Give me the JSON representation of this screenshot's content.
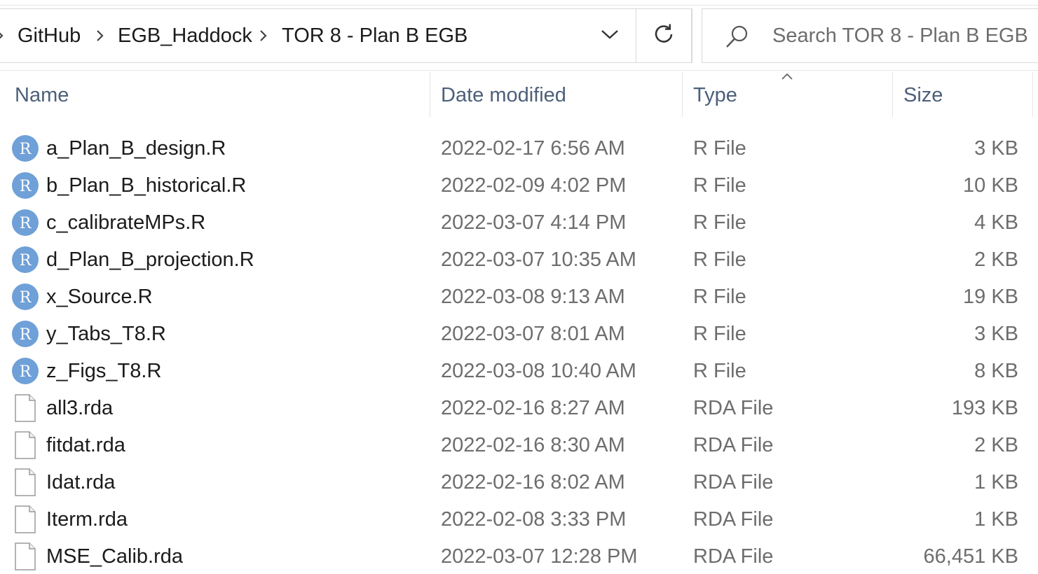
{
  "breadcrumb": {
    "items": [
      "GitHub",
      "EGB_Haddock",
      "TOR 8 - Plan B EGB"
    ]
  },
  "search": {
    "placeholder": "Search TOR 8 - Plan B EGB"
  },
  "columns": {
    "name": "Name",
    "date": "Date modified",
    "type": "Type",
    "size": "Size"
  },
  "icons": {
    "r_file": "r-file-icon",
    "generic_file": "generic-file-icon",
    "r_letter": "R",
    "r_icon_color": "#6fa0d8"
  },
  "files": [
    {
      "name": "a_Plan_B_design.R",
      "date": "2022-02-17 6:56 AM",
      "type": "R File",
      "size": "3 KB",
      "icon": "r"
    },
    {
      "name": "b_Plan_B_historical.R",
      "date": "2022-02-09 4:02 PM",
      "type": "R File",
      "size": "10 KB",
      "icon": "r"
    },
    {
      "name": "c_calibrateMPs.R",
      "date": "2022-03-07 4:14 PM",
      "type": "R File",
      "size": "4 KB",
      "icon": "r"
    },
    {
      "name": "d_Plan_B_projection.R",
      "date": "2022-03-07 10:35 AM",
      "type": "R File",
      "size": "2 KB",
      "icon": "r"
    },
    {
      "name": "x_Source.R",
      "date": "2022-03-08 9:13 AM",
      "type": "R File",
      "size": "19 KB",
      "icon": "r"
    },
    {
      "name": "y_Tabs_T8.R",
      "date": "2022-03-07 8:01 AM",
      "type": "R File",
      "size": "3 KB",
      "icon": "r"
    },
    {
      "name": "z_Figs_T8.R",
      "date": "2022-03-08 10:40 AM",
      "type": "R File",
      "size": "8 KB",
      "icon": "r"
    },
    {
      "name": "all3.rda",
      "date": "2022-02-16 8:27 AM",
      "type": "RDA File",
      "size": "193 KB",
      "icon": "file"
    },
    {
      "name": "fitdat.rda",
      "date": "2022-02-16 8:30 AM",
      "type": "RDA File",
      "size": "2 KB",
      "icon": "file"
    },
    {
      "name": "Idat.rda",
      "date": "2022-02-16 8:02 AM",
      "type": "RDA File",
      "size": "1 KB",
      "icon": "file"
    },
    {
      "name": "Iterm.rda",
      "date": "2022-02-08 3:33 PM",
      "type": "RDA File",
      "size": "1 KB",
      "icon": "file"
    },
    {
      "name": "MSE_Calib.rda",
      "date": "2022-03-07 12:28 PM",
      "type": "RDA File",
      "size": "66,451 KB",
      "icon": "file"
    }
  ]
}
